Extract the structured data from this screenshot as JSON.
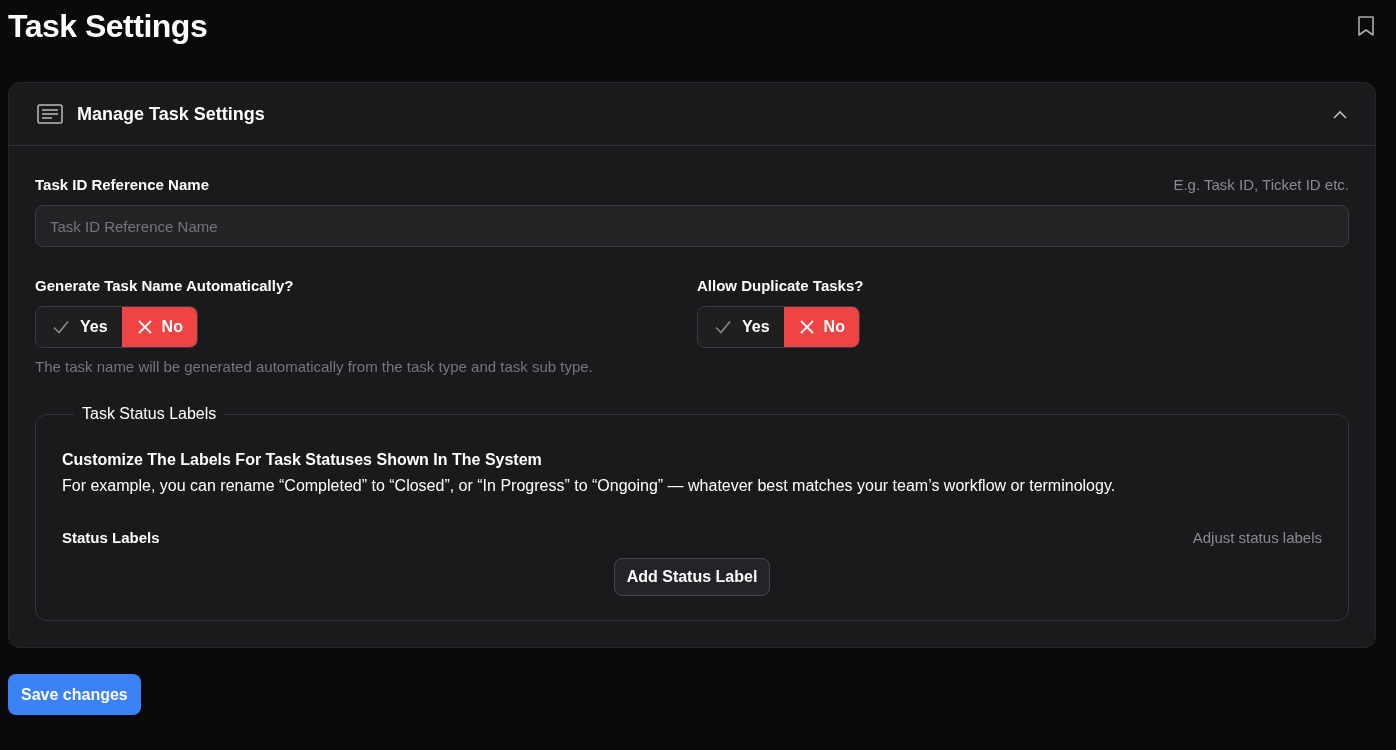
{
  "page": {
    "title": "Task Settings"
  },
  "card": {
    "title": "Manage Task Settings",
    "expanded": true
  },
  "reference": {
    "label": "Task ID Reference Name",
    "hint": "E.g. Task ID, Ticket ID etc.",
    "placeholder": "Task ID Reference Name"
  },
  "toggles": [
    {
      "label": "Generate Task Name Automatically?",
      "options": [
        {
          "kind": "yes",
          "label": "Yes",
          "selected": false
        },
        {
          "kind": "no",
          "label": "No",
          "selected": true
        }
      ],
      "help": "The task name will be generated automatically from the task type and task sub type."
    },
    {
      "label": "Allow Duplicate Tasks?",
      "options": [
        {
          "kind": "yes",
          "label": "Yes",
          "selected": false
        },
        {
          "kind": "no",
          "label": "No",
          "selected": true
        }
      ]
    }
  ],
  "status_labels": {
    "legend": "Task Status Labels",
    "heading": "Customize The Labels For Task Statuses Shown In The System",
    "description": "For example, you can rename “Completed” to “Closed”, or “In Progress” to “Ongoing” — whatever best matches your team’s workflow or terminology.",
    "label": "Status Labels",
    "hint": "Adjust status labels",
    "add_button": "Add Status Label"
  },
  "save_button": "Save changes"
}
